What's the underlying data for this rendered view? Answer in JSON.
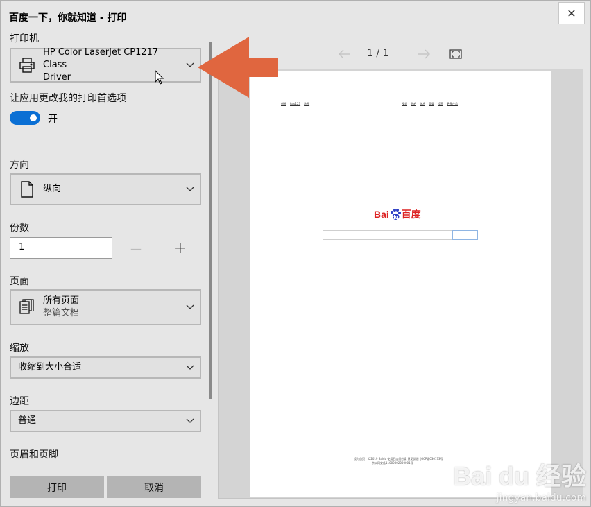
{
  "window": {
    "title": "百度一下，你就知道 - 打印",
    "close_symbol": "✕"
  },
  "settings": {
    "printer": {
      "label": "打印机",
      "selected_line1": "HP Color LaserJet CP1217 Class",
      "selected_line2": "Driver"
    },
    "app_pref": {
      "label": "让应用更改我的打印首选项",
      "toggle_state": "开",
      "toggle_on": true
    },
    "orientation": {
      "label": "方向",
      "selected": "纵向"
    },
    "copies": {
      "label": "份数",
      "value": "1",
      "minus": "—",
      "plus": "+"
    },
    "pages": {
      "label": "页面",
      "selected_line1": "所有页面",
      "selected_line2": "整篇文档"
    },
    "scale": {
      "label": "缩放",
      "selected": "收缩到大小合适"
    },
    "margins": {
      "label": "边距",
      "selected": "普通"
    },
    "header_footer": {
      "label": "页眉和页脚"
    }
  },
  "actions": {
    "print_label": "打印",
    "cancel_label": "取消"
  },
  "preview": {
    "page_indicator": "1  /  1",
    "top_left_links": [
      "新闻",
      "hao123",
      "地图"
    ],
    "top_right_links": [
      "视频",
      "贴吧",
      "学术",
      "登录",
      "设置",
      "更多产品"
    ],
    "logo_text_left": "Bai",
    "logo_text_mid": "du",
    "logo_text_right": "百度",
    "footer_line1_link": "设为首页",
    "footer_line1_text": "©2019 Baidu 使用百度前必读 意见反馈 京ICP证030173号",
    "footer_line2_text": "京公网安备11000002000001号"
  },
  "watermark": {
    "brand": "Bai du 经验",
    "site": "jingyan.baidu.com"
  },
  "colors": {
    "toggle_on": "#0a6fd4",
    "arrow": "#e0663f",
    "baidu_red": "#dd2222",
    "baidu_blue": "#2d3fc4"
  }
}
